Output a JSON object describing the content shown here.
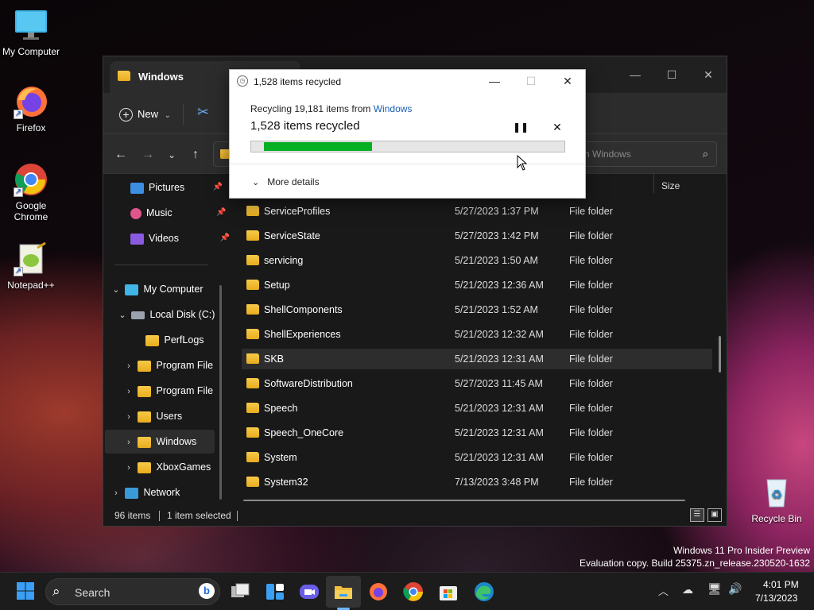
{
  "desktop": {
    "icons": [
      {
        "label": "My Computer"
      },
      {
        "label": "Firefox"
      },
      {
        "label": "Google Chrome"
      },
      {
        "label": "Notepad++"
      },
      {
        "label": "Recycle Bin"
      }
    ],
    "watermark_line1": "Windows 11 Pro Insider Preview",
    "watermark_line2": "Evaluation copy. Build 25375.zn_release.230520-1632"
  },
  "explorer": {
    "tab_title": "Windows",
    "new_label": "New",
    "search_placeholder": "h Windows",
    "size_header": "Size",
    "nav_quick": [
      {
        "label": "Pictures",
        "icon": "pictures-icon"
      },
      {
        "label": "Music",
        "icon": "music-icon"
      },
      {
        "label": "Videos",
        "icon": "videos-icon"
      }
    ],
    "nav_tree": [
      {
        "label": "My Computer",
        "chevron": "⌄"
      },
      {
        "label": "Local Disk (C:)",
        "chevron": "⌄"
      },
      {
        "label": "PerfLogs",
        "chevron": ""
      },
      {
        "label": "Program File",
        "chevron": "›"
      },
      {
        "label": "Program File",
        "chevron": "›"
      },
      {
        "label": "Users",
        "chevron": "›"
      },
      {
        "label": "Windows",
        "chevron": "›"
      },
      {
        "label": "XboxGames",
        "chevron": "›"
      },
      {
        "label": "Network",
        "chevron": "›"
      }
    ],
    "files": [
      {
        "name": "ServiceProfiles",
        "date": "5/27/2023 1:37 PM",
        "type": "File folder"
      },
      {
        "name": "ServiceState",
        "date": "5/27/2023 1:42 PM",
        "type": "File folder"
      },
      {
        "name": "servicing",
        "date": "5/21/2023 1:50 AM",
        "type": "File folder"
      },
      {
        "name": "Setup",
        "date": "5/21/2023 12:36 AM",
        "type": "File folder"
      },
      {
        "name": "ShellComponents",
        "date": "5/21/2023 1:52 AM",
        "type": "File folder"
      },
      {
        "name": "ShellExperiences",
        "date": "5/21/2023 12:32 AM",
        "type": "File folder"
      },
      {
        "name": "SKB",
        "date": "5/21/2023 12:31 AM",
        "type": "File folder"
      },
      {
        "name": "SoftwareDistribution",
        "date": "5/27/2023 11:45 AM",
        "type": "File folder"
      },
      {
        "name": "Speech",
        "date": "5/21/2023 12:31 AM",
        "type": "File folder"
      },
      {
        "name": "Speech_OneCore",
        "date": "5/21/2023 12:31 AM",
        "type": "File folder"
      },
      {
        "name": "System",
        "date": "5/21/2023 12:31 AM",
        "type": "File folder"
      },
      {
        "name": "System32",
        "date": "7/13/2023 3:48 PM",
        "type": "File folder"
      }
    ],
    "status_items": "96 items",
    "status_selected": "1 item selected"
  },
  "dialog": {
    "title": "1,528 items recycled",
    "from_prefix": "Recycling 19,181 items from ",
    "from_link": "Windows",
    "headline": "1,528 items recycled",
    "progress": 0.36,
    "more_details": "More details"
  },
  "taskbar": {
    "search_label": "Search",
    "time": "4:01 PM",
    "date": "7/13/2023"
  },
  "colors": {
    "accent_link": "#1a5fb4",
    "progress_fill": "#06b025",
    "folder": "#f2bd3a"
  }
}
